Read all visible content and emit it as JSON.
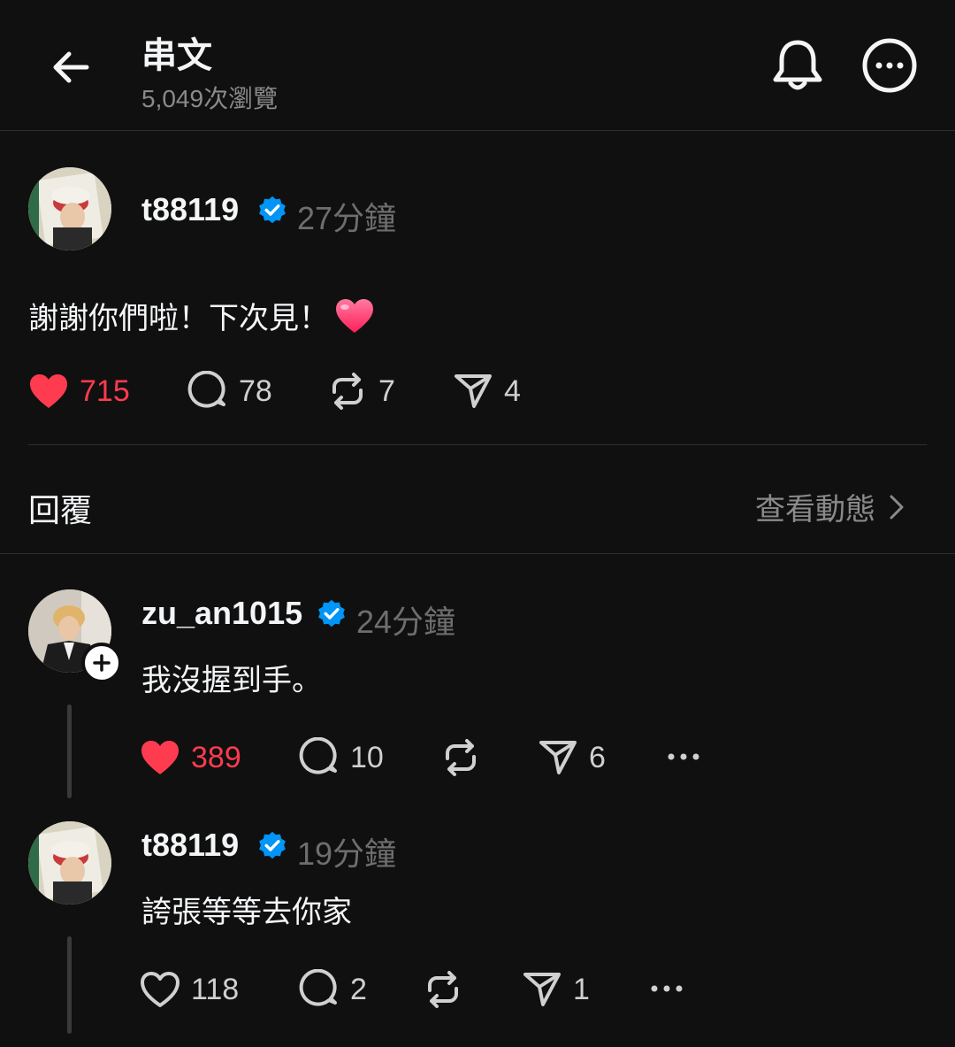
{
  "header": {
    "title": "串文",
    "views": "5,049次瀏覽"
  },
  "post": {
    "username": "t88119",
    "time": "27分鐘",
    "text": "謝謝你們啦！下次見！",
    "emoji": "❤️",
    "likes": "715",
    "comments": "78",
    "reposts": "7",
    "shares": "4"
  },
  "replies_section": {
    "label": "回覆",
    "activity_link": "查看動態"
  },
  "replies": [
    {
      "username": "zu_an1015",
      "time": "24分鐘",
      "text": "我沒握到手。",
      "likes": "389",
      "comments": "10",
      "reposts": "",
      "shares": "6"
    },
    {
      "username": "t88119",
      "time": "19分鐘",
      "text": "誇張等等去你家",
      "likes": "118",
      "comments": "2",
      "reposts": "",
      "shares": "1"
    }
  ],
  "colors": {
    "background": "#101010",
    "like_red": "#ff3b4f",
    "verified_blue": "#0095f6",
    "muted_text": "#8a8a8a"
  },
  "icons": [
    "back-arrow-icon",
    "bell-icon",
    "more-icon",
    "verified-icon",
    "heart-icon",
    "comment-icon",
    "repost-icon",
    "share-icon",
    "chevron-right-icon",
    "plus-icon"
  ]
}
